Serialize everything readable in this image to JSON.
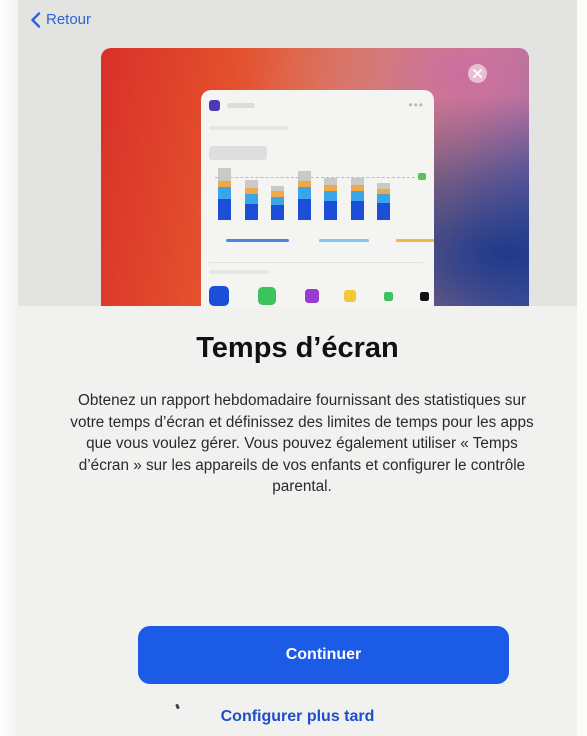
{
  "nav": {
    "back_label": "Retour"
  },
  "screen_time": {
    "title": "Temps d’écran",
    "description": "Obtenez un rapport hebdomadaire fournissant des statistiques sur votre temps d’écran et définissez des limites de temps pour les apps que vous voulez gérer. Vous pouvez également utiliser « Temps d’écran » sur les appareils de vos enfants et configurer le contrôle parental.",
    "continue_label": "Continuer",
    "later_label": "Configurer plus tard"
  },
  "colors": {
    "accent": "#1b5be6",
    "link": "#2b62d9",
    "bar_dark": "#1c4fd8",
    "bar_mid": "#3aa6e8",
    "bar_orange": "#f2a844",
    "bar_gray": "#c9c9c7"
  },
  "icons": {
    "back": "chevron-left-icon",
    "close": "close-icon"
  },
  "illustration": {
    "bars": [
      {
        "gray": 0.25,
        "orange": 0.12,
        "mid": 0.22,
        "dark": 0.41
      },
      {
        "gray": 0.15,
        "orange": 0.12,
        "mid": 0.2,
        "dark": 0.3
      },
      {
        "gray": 0.1,
        "orange": 0.1,
        "mid": 0.17,
        "dark": 0.28
      },
      {
        "gray": 0.2,
        "orange": 0.12,
        "mid": 0.22,
        "dark": 0.41
      },
      {
        "gray": 0.12,
        "orange": 0.12,
        "mid": 0.2,
        "dark": 0.36
      },
      {
        "gray": 0.12,
        "orange": 0.12,
        "mid": 0.2,
        "dark": 0.36
      },
      {
        "gray": 0.12,
        "orange": 0.1,
        "mid": 0.18,
        "dark": 0.32
      }
    ],
    "legend_colors": [
      "#4a86e0",
      "#7ec7ef",
      "#f2b64a"
    ],
    "app_icon_colors": [
      "#1c4fd8",
      "#3cc35e",
      "#9b3bd1",
      "#f3c837",
      "#3cc35e",
      "#111111"
    ]
  }
}
